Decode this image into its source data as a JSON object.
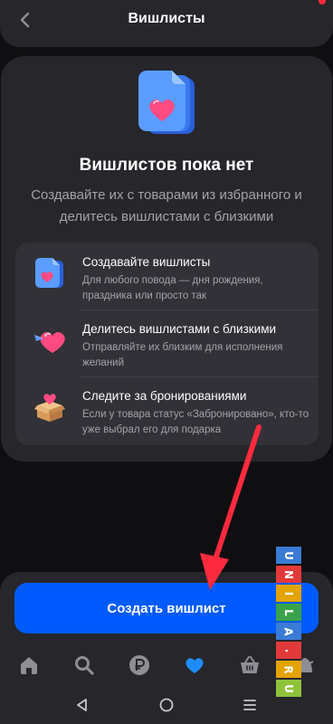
{
  "header": {
    "title": "Вишлисты"
  },
  "empty_state": {
    "title": "Вишлистов пока нет",
    "description": "Создавайте их с товарами из избранного и делитесь вишлистами с близкими"
  },
  "features": [
    {
      "icon": "wishlist-doc-icon",
      "title": "Создавайте вишлисты",
      "description": "Для любого повода — дня рождения, праздника или просто так"
    },
    {
      "icon": "flying-heart-icon",
      "title": "Делитесь вишлистами с близкими",
      "description": "Отправляйте их близким для исполнения желаний"
    },
    {
      "icon": "gift-box-icon",
      "title": "Следите за бронированиями",
      "description": "Если у товара статус «Забронировано», кто-то уже выбрал его для подарка"
    }
  ],
  "create_button": {
    "label": "Создать вишлист"
  },
  "bottom_nav": [
    {
      "name": "home-icon",
      "active": false
    },
    {
      "name": "search-icon",
      "active": false
    },
    {
      "name": "ruble-icon",
      "active": false
    },
    {
      "name": "heart-icon",
      "active": true
    },
    {
      "name": "basket-icon",
      "active": false
    },
    {
      "name": "profile-icon",
      "active": false
    }
  ],
  "system_nav": [
    "back-triangle-icon",
    "home-circle-icon",
    "recents-icon"
  ],
  "watermark": {
    "letters": [
      "U",
      "N",
      "I",
      "L",
      "A",
      ".",
      "R",
      "U"
    ],
    "colors": [
      "#3a7bd5",
      "#e23a3a",
      "#e5a300",
      "#3aa34a",
      "#3a7bd5",
      "#e23a3a",
      "#e5a300",
      "#8fc23a"
    ]
  },
  "colors": {
    "accent": "#005bff",
    "active_nav": "#1e8cff",
    "heart": "#ff3a78",
    "arrow": "#ff2a40"
  }
}
